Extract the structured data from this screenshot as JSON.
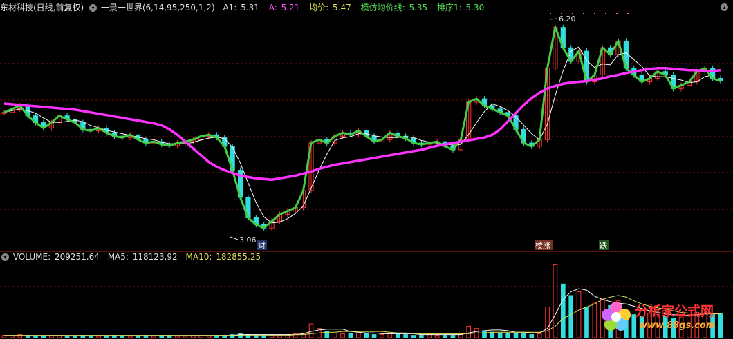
{
  "header": {
    "stock": "东材科技(日线,前复权)",
    "indicator": "一景一世界(6,14,95,250,1,2)",
    "a1_label": "A1:",
    "a1_value": "5.31",
    "a_label": "A:",
    "a_value": "5.21",
    "avg_label": "均价:",
    "avg_value": "5.47",
    "mimic_label": "模仿均价线:",
    "mimic_value": "5.35",
    "rank_label": "排序1:",
    "rank_value": "5.30"
  },
  "volume_header": {
    "volume_label": "VOLUME:",
    "volume_value": "209251.64",
    "ma5_label": "MA5:",
    "ma5_value": "118123.92",
    "ma10_label": "MA10:",
    "ma10_value": "182855.25"
  },
  "annotations": {
    "high_label": "6.20",
    "low_label": "3.06",
    "mark_cai": "财",
    "mark_limit_up": "楼涨",
    "mark_fall": "跌"
  },
  "watermark": {
    "name": "分析家公式网",
    "url": "www.88gs.com"
  },
  "colors": {
    "background": "#000000",
    "up": "#ff3333",
    "down": "#33dddd",
    "price_line": "#44cc44",
    "avg_line": "#ff33ff",
    "ma_line": "#ffffff",
    "grid": "#7a1010",
    "a1": "#dddddd",
    "a": "#ff55ff",
    "avg": "#dddd55",
    "mimic": "#55dd55"
  },
  "chart_data": {
    "type": "candlestick",
    "price_range": [
      3.0,
      6.3
    ],
    "close": [
      4.85,
      4.9,
      4.95,
      4.8,
      4.7,
      4.62,
      4.7,
      4.8,
      4.75,
      4.7,
      4.6,
      4.58,
      4.62,
      4.55,
      4.5,
      4.48,
      4.52,
      4.45,
      4.4,
      4.42,
      4.38,
      4.36,
      4.4,
      4.42,
      4.45,
      4.5,
      4.52,
      4.48,
      4.35,
      4.0,
      3.6,
      3.3,
      3.2,
      3.15,
      3.25,
      3.35,
      3.4,
      3.45,
      3.7,
      4.4,
      4.45,
      4.4,
      4.5,
      4.55,
      4.52,
      4.58,
      4.5,
      4.42,
      4.45,
      4.55,
      4.5,
      4.47,
      4.4,
      4.38,
      4.4,
      4.42,
      4.35,
      4.3,
      4.45,
      5.0,
      5.05,
      4.95,
      4.9,
      4.85,
      4.8,
      4.6,
      4.4,
      4.35,
      4.45,
      5.5,
      6.1,
      5.8,
      5.6,
      5.75,
      5.3,
      5.4,
      5.8,
      5.7,
      5.9,
      5.5,
      5.4,
      5.3,
      5.35,
      5.45,
      5.4,
      5.2,
      5.25,
      5.3,
      5.45,
      5.5,
      5.35,
      5.31
    ],
    "avg_line": [
      4.98,
      4.97,
      4.96,
      4.95,
      4.94,
      4.93,
      4.92,
      4.91,
      4.9,
      4.89,
      4.87,
      4.85,
      4.83,
      4.81,
      4.79,
      4.77,
      4.75,
      4.73,
      4.71,
      4.69,
      4.66,
      4.6,
      4.52,
      4.42,
      4.32,
      4.22,
      4.12,
      4.05,
      4.0,
      3.96,
      3.92,
      3.9,
      3.88,
      3.87,
      3.86,
      3.88,
      3.9,
      3.92,
      3.95,
      3.98,
      4.02,
      4.05,
      4.08,
      4.1,
      4.12,
      4.14,
      4.16,
      4.18,
      4.2,
      4.22,
      4.24,
      4.26,
      4.28,
      4.3,
      4.33,
      4.36,
      4.38,
      4.4,
      4.42,
      4.44,
      4.46,
      4.48,
      4.52,
      4.6,
      4.72,
      4.84,
      4.96,
      5.06,
      5.14,
      5.2,
      5.24,
      5.27,
      5.29,
      5.3,
      5.31,
      5.33,
      5.35,
      5.38,
      5.4,
      5.43,
      5.45,
      5.47,
      5.49,
      5.5,
      5.5,
      5.49,
      5.48,
      5.47,
      5.47,
      5.46,
      5.46,
      5.47
    ],
    "volume_range": [
      0,
      100
    ],
    "volume": [
      3,
      3,
      4,
      3,
      2,
      2,
      3,
      3,
      2,
      2,
      3,
      2,
      2,
      2,
      3,
      2,
      2,
      2,
      3,
      2,
      3,
      3,
      2,
      2,
      3,
      3,
      2,
      3,
      3,
      4,
      5,
      4,
      3,
      3,
      3,
      3,
      4,
      5,
      6,
      18,
      12,
      8,
      6,
      5,
      5,
      6,
      5,
      4,
      4,
      5,
      5,
      4,
      3,
      3,
      4,
      3,
      3,
      3,
      4,
      15,
      12,
      9,
      7,
      6,
      5,
      6,
      5,
      4,
      5,
      40,
      95,
      70,
      55,
      60,
      40,
      45,
      50,
      42,
      48,
      35,
      30,
      28,
      32,
      30,
      28,
      25,
      27,
      30,
      33,
      35,
      30,
      31
    ],
    "ma5": [
      3,
      3,
      3,
      3,
      3,
      3,
      3,
      3,
      3,
      3,
      3,
      3,
      3,
      3,
      3,
      3,
      3,
      3,
      3,
      3,
      3,
      3,
      3,
      3,
      3,
      3,
      3,
      3,
      3,
      3,
      4,
      4,
      4,
      4,
      4,
      4,
      4,
      4,
      5,
      8,
      10,
      11,
      11,
      11,
      8,
      7,
      6,
      6,
      5,
      5,
      5,
      5,
      5,
      4,
      4,
      4,
      4,
      4,
      4,
      6,
      8,
      9,
      10,
      10,
      9,
      7,
      7,
      6,
      6,
      12,
      30,
      50,
      60,
      64,
      62,
      54,
      50,
      47,
      45,
      44,
      41,
      38,
      35,
      33,
      31,
      30,
      29,
      29,
      30,
      31,
      31,
      32
    ],
    "ma10": [
      3,
      3,
      3,
      3,
      3,
      3,
      3,
      3,
      3,
      3,
      3,
      3,
      3,
      3,
      3,
      3,
      3,
      3,
      3,
      3,
      3,
      3,
      3,
      3,
      3,
      3,
      3,
      3,
      3,
      3,
      3,
      3,
      3,
      3,
      3,
      3,
      3,
      4,
      4,
      5,
      6,
      7,
      7,
      8,
      8,
      8,
      8,
      8,
      8,
      7,
      6,
      6,
      5,
      5,
      5,
      5,
      5,
      5,
      5,
      5,
      6,
      6,
      7,
      7,
      7,
      7,
      7,
      7,
      7,
      9,
      15,
      25,
      30,
      36,
      40,
      44,
      50,
      53,
      55,
      53,
      48,
      44,
      41,
      39,
      37,
      35,
      33,
      32,
      32,
      32,
      31,
      31
    ]
  }
}
